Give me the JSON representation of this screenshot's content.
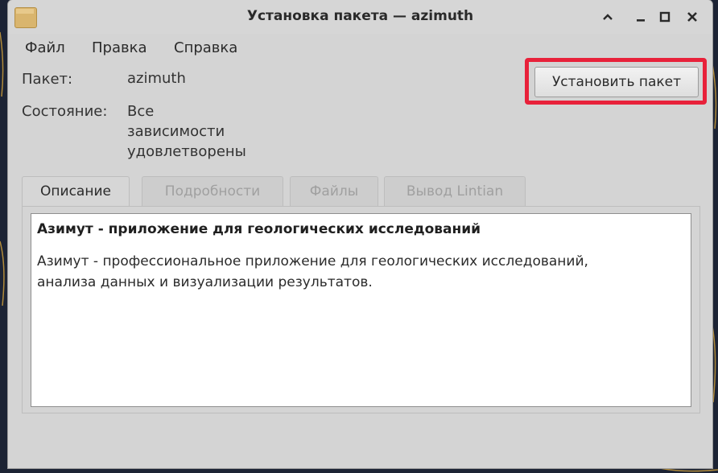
{
  "window": {
    "title": "Установка пакета — azimuth"
  },
  "menu": {
    "items": [
      "Файл",
      "Правка",
      "Справка"
    ]
  },
  "package": {
    "label": "Пакет:",
    "value": "azimuth"
  },
  "status": {
    "label": "Состояние:",
    "value_lines": [
      "Все",
      "зависимости",
      "удовлетворены"
    ]
  },
  "install_button": {
    "label": "Установить пакет"
  },
  "tabs": [
    {
      "label": "Описание",
      "active": true
    },
    {
      "label": "Подробности",
      "active": false
    },
    {
      "label": "Файлы",
      "active": false
    },
    {
      "label": "Вывод Lintian",
      "active": false
    }
  ],
  "description": {
    "heading": "Азимут - приложение для геологических исследований",
    "lines": [
      "Азимут - профессиональное приложение для геологических исследований,",
      "анализа данных и визуализации результатов."
    ]
  },
  "window_controls": {
    "minimize_icon": "chevron-up-icon",
    "minimize2_icon": "minimize-icon",
    "maximize_icon": "maximize-icon",
    "close_icon": "close-icon"
  },
  "colors": {
    "highlight": "#e8213a",
    "window_bg": "#d4d4d4",
    "desktop_bg": "#1c2334"
  }
}
